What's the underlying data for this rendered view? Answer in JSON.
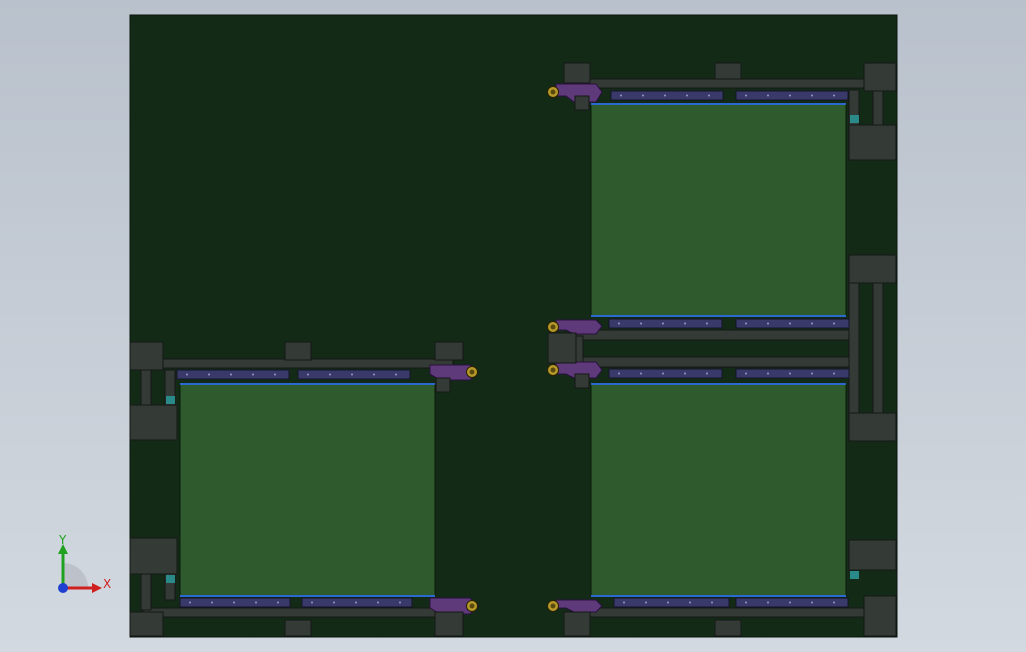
{
  "viewport": {
    "background_top": "#b9c1cc",
    "background_bottom": "#d3d9e0"
  },
  "model": {
    "base_plate_color": "#132a17",
    "panel_color": "#2e5a2e",
    "frame_color": "#343a36",
    "frame_outline": "#151815",
    "rail_color": "#3a3a6a",
    "bracket_color": "#5e3a7a",
    "screw_color": "#b59a2a",
    "accent_blue": "#2a6ad0",
    "accent_teal": "#2a8a8a"
  },
  "triad": {
    "y_label": "Y",
    "x_label": "X",
    "y_color": "#1fa01f",
    "x_color": "#d01f1f",
    "z_color": "#1f3fd0"
  }
}
